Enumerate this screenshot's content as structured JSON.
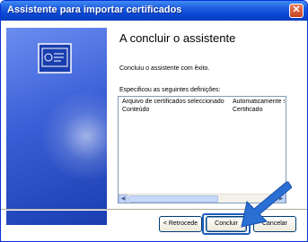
{
  "window": {
    "title": "Assistente para importar certificados",
    "close_glyph": "✕"
  },
  "wizard": {
    "heading": "A concluir o assistente",
    "message": "Concluiu o assistente com êxito.",
    "settings_label": "Especificou as seguintes definições:",
    "settings_rows": [
      {
        "name": "Arquivo de certificados seleccionado",
        "value": "Automaticamente s"
      },
      {
        "name": "Conteúdo",
        "value": "Certificado"
      }
    ]
  },
  "buttons": {
    "back": "< Retrocede",
    "finish": "Concluir",
    "cancel": "Cancelar"
  },
  "colors": {
    "title_bar": "#0a46d2",
    "side_panel": "#3a5fd6",
    "pointer_arrow": "#2a6fd4"
  },
  "icons": {
    "side": "certificate-icon",
    "pointer": "arrow-pointer-icon"
  }
}
